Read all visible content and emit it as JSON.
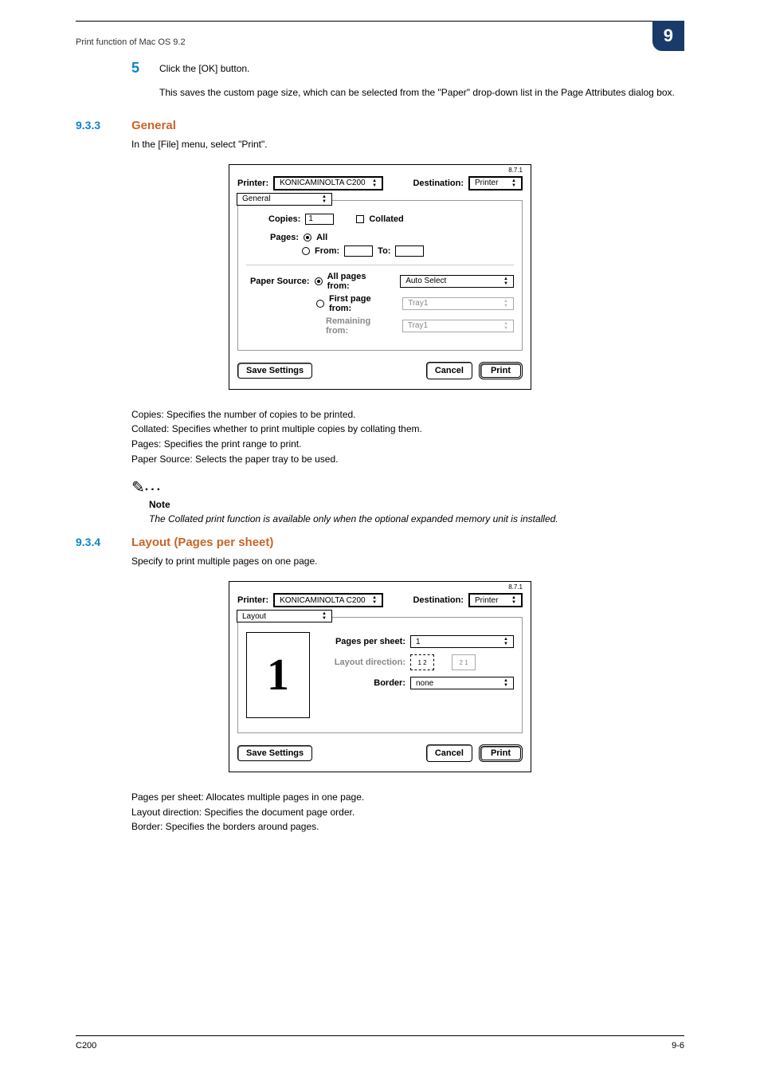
{
  "header": {
    "title": "Print function of Mac OS 9.2",
    "badge": "9"
  },
  "step5": {
    "num": "5",
    "text": "Click the [OK] button.",
    "para": "This saves the custom page size, which can be selected from the \"Paper\" drop-down list in the Page Attributes dialog box."
  },
  "sec933": {
    "num": "9.3.3",
    "title": "General",
    "intro": "In the [File] menu, select \"Print\"."
  },
  "dlgGeneral": {
    "version": "8.7.1",
    "printerLabel": "Printer:",
    "printerValue": "KONICAMINOLTA C200",
    "destLabel": "Destination:",
    "destValue": "Printer",
    "panel": "General",
    "copiesLabel": "Copies:",
    "copiesValue": "1",
    "collatedLabel": "Collated",
    "pagesLabel": "Pages:",
    "allLabel": "All",
    "fromLabel": "From:",
    "toLabel": "To:",
    "paperSourceLabel": "Paper Source:",
    "allPagesFromLabel": "All pages from:",
    "autoSelect": "Auto Select",
    "firstPageLabel": "First page from:",
    "tray1a": "Tray1",
    "remainingLabel": "Remaining from:",
    "tray1b": "Tray1",
    "saveBtn": "Save Settings",
    "cancelBtn": "Cancel",
    "printBtn": "Print"
  },
  "generalDefs": {
    "copies": "Copies: Specifies the number of copies to be printed.",
    "collated": "Collated: Specifies whether to print multiple copies by collating them.",
    "pages": "Pages: Specifies the print range to print.",
    "paperSource": "Paper Source: Selects the paper tray to be used."
  },
  "note": {
    "label": "Note",
    "text": "The Collated print function is available only when the optional expanded memory unit is installed."
  },
  "sec934": {
    "num": "9.3.4",
    "title": "Layout (Pages per sheet)",
    "intro": "Specify to print multiple pages on one page."
  },
  "dlgLayout": {
    "version": "8.7.1",
    "printerLabel": "Printer:",
    "printerValue": "KONICAMINOLTA C200",
    "destLabel": "Destination:",
    "destValue": "Printer",
    "panel": "Layout",
    "ppsLabel": "Pages per sheet:",
    "ppsValue": "1",
    "dirLabel": "Layout direction:",
    "dir1": "1  2",
    "dir2": "2  1",
    "borderLabel": "Border:",
    "borderValue": "none",
    "previewNum": "1",
    "saveBtn": "Save Settings",
    "cancelBtn": "Cancel",
    "printBtn": "Print"
  },
  "layoutDefs": {
    "pps": "Pages per sheet: Allocates multiple pages in one page.",
    "dir": "Layout direction: Specifies the document page order.",
    "border": "Border: Specifies the borders around pages."
  },
  "footer": {
    "left": "C200",
    "right": "9-6"
  }
}
